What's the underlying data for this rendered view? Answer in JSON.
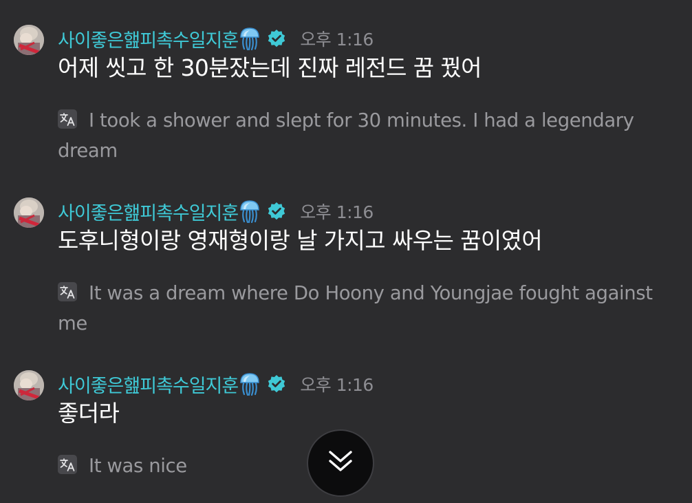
{
  "messages": [
    {
      "username": "사이좋은햂피촉수일지훈",
      "timestamp": "오후 1:16",
      "text": "어제 씻고 한 30분잤는데 진짜 레전드 꿈 꿨어",
      "translation": "I took a shower and slept for 30 minutes. I had a legendary dream"
    },
    {
      "username": "사이좋은햂피촉수일지훈",
      "timestamp": "오후 1:16",
      "text": "도후니형이랑 영재형이랑 날 가지고 싸우는 꿈이였어",
      "translation": "It was a dream where Do Hoony and Youngjae fought against me"
    },
    {
      "username": "사이좋은햂피촉수일지훈",
      "timestamp": "오후 1:16",
      "text": "좋더라",
      "translation": "It was nice"
    }
  ],
  "icons": {
    "username_emoji": "jellyfish-icon",
    "verified": "verified-badge-icon",
    "translate": "translate-icon",
    "scroll": "double-chevron-down-icon"
  },
  "colors": {
    "background": "#2c2c2e",
    "username": "#3fc9d6",
    "verified": "#3fc9d6",
    "message_text": "#ffffff",
    "secondary_text": "#9a9a9e",
    "scroll_button": "#0c0c0d"
  }
}
